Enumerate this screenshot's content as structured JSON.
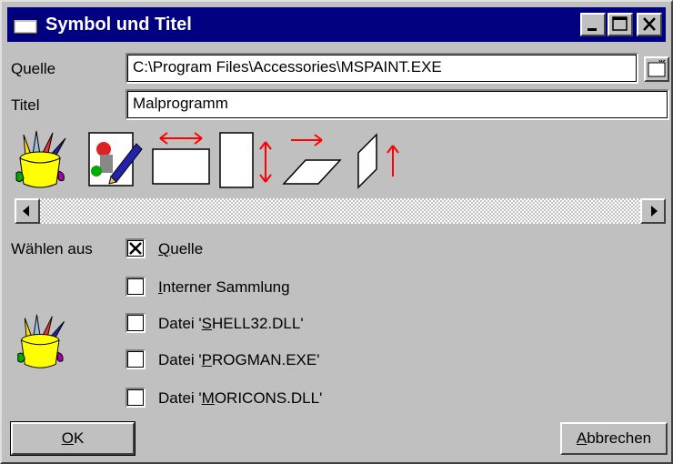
{
  "window": {
    "title": "Symbol und Titel",
    "title_icon": "window-icon",
    "controls": [
      "minimize-icon",
      "maximize-icon",
      "close-icon"
    ]
  },
  "form": {
    "source_label": "Quelle",
    "source_value": "C:\\Program Files\\Accessories\\MSPAINT.EXE",
    "title_label": "Titel",
    "title_value": "Malprogramm",
    "browse_icon": "folder-icon"
  },
  "icons": [
    "paint-bucket-icon",
    "paint-document-icon",
    "landscape-page-icon",
    "portrait-page-icon",
    "skew-horizontal-icon",
    "skew-vertical-icon"
  ],
  "choose_from": {
    "label": "Wählen aus",
    "options": [
      {
        "prefix": "",
        "mnemonic": "Q",
        "rest": "uelle",
        "checked": true
      },
      {
        "prefix": "",
        "mnemonic": "I",
        "rest": "nterner Sammlung",
        "checked": false
      },
      {
        "prefix": "Datei '",
        "mnemonic": "S",
        "rest": "HELL32.DLL'",
        "checked": false
      },
      {
        "prefix": "Datei '",
        "mnemonic": "P",
        "rest": "ROGMAN.EXE'",
        "checked": false
      },
      {
        "prefix": "Datei '",
        "mnemonic": "M",
        "rest": "ORICONS.DLL'",
        "checked": false
      }
    ]
  },
  "buttons": {
    "ok_mnemonic": "O",
    "ok_rest": "K",
    "cancel_mnemonic": "A",
    "cancel_rest": "bbrechen"
  },
  "colors": {
    "titlebar": "#000080",
    "face": "#c0c0c0",
    "arrow_red": "#ff0000"
  }
}
